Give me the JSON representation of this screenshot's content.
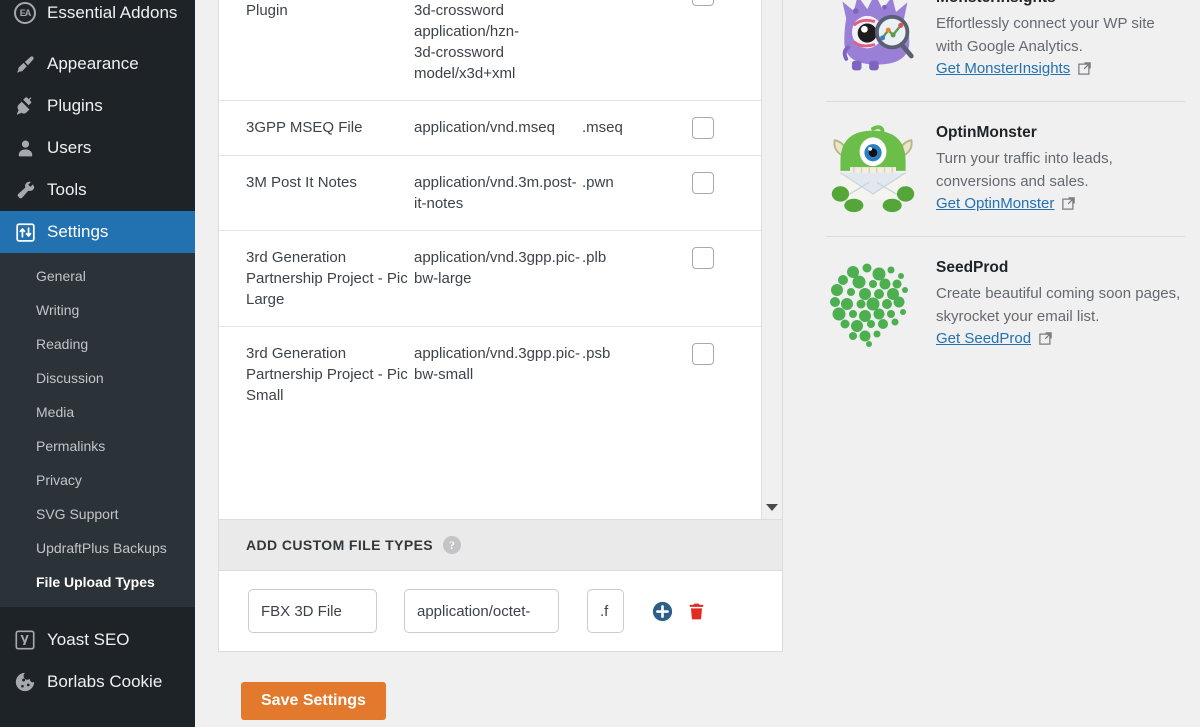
{
  "sidebar": {
    "top_items": [
      {
        "label": "Essential Addons",
        "icon": "essential-addons-icon"
      },
      {
        "label": "Appearance",
        "icon": "paintbrush-icon"
      },
      {
        "label": "Plugins",
        "icon": "plug-icon"
      },
      {
        "label": "Users",
        "icon": "user-icon"
      },
      {
        "label": "Tools",
        "icon": "wrench-icon"
      },
      {
        "label": "Settings",
        "icon": "sliders-icon",
        "current": true
      }
    ],
    "submenu": [
      {
        "label": "General"
      },
      {
        "label": "Writing"
      },
      {
        "label": "Reading"
      },
      {
        "label": "Discussion"
      },
      {
        "label": "Media"
      },
      {
        "label": "Permalinks"
      },
      {
        "label": "Privacy"
      },
      {
        "label": "SVG Support"
      },
      {
        "label": "UpdraftPlus Backups"
      },
      {
        "label": "File Upload Types",
        "current": true
      }
    ],
    "bottom_items": [
      {
        "label": "Yoast SEO",
        "icon": "yoast-icon"
      },
      {
        "label": "Borlabs Cookie",
        "icon": "borlabs-cookie-icon"
      }
    ],
    "accent_current": "#2271b1",
    "background": "#1d2327",
    "submenu_background": "#2c3338"
  },
  "file_types_table": {
    "rows": [
      {
        "description": "Plugin",
        "mime": "3d-crossword\napplication/hzn-\n3d-crossword\nmodel/x3d+xml",
        "extension": "",
        "checked": false,
        "clipped": true
      },
      {
        "description": "3GPP MSEQ File",
        "mime": "application/vnd.mseq",
        "extension": ".mseq",
        "checked": false
      },
      {
        "description": "3M Post It Notes",
        "mime": "application/vnd.3m.post-\nit-notes",
        "extension": ".pwn",
        "checked": false
      },
      {
        "description": "3rd Generation Partnership Project - Pic Large",
        "mime": "application/vnd.3gpp.pic-\nbw-large",
        "extension": ".plb",
        "checked": false
      },
      {
        "description": "3rd Generation Partnership Project - Pic Small",
        "mime": "application/vnd.3gpp.pic-\nbw-small",
        "extension": ".psb",
        "checked": false
      }
    ]
  },
  "add_custom_section": {
    "heading": "ADD CUSTOM FILE TYPES",
    "help_glyph": "?",
    "row": {
      "description_value": "FBX 3D File",
      "mime_value": "application/octet-",
      "extension_value": ".f",
      "add_icon": "add-circle-icon",
      "delete_icon": "trash-icon",
      "add_color": "#2c5f8a",
      "delete_color": "#e02b20"
    }
  },
  "actions": {
    "save_label": "Save Settings",
    "save_color": "#e2792d"
  },
  "promos": [
    {
      "name": "MonsterInsights",
      "description": "Effortlessly connect your WP site with Google Analytics.",
      "link_label": "Get MonsterInsights",
      "link_icon": "external-link-icon",
      "thumb": "monsterinsights-logo",
      "color": "#8c68cd"
    },
    {
      "name": "OptinMonster",
      "description": "Turn your traffic into leads, conversions and sales.",
      "link_label": "Get OptinMonster",
      "link_icon": "external-link-icon",
      "thumb": "optinmonster-logo",
      "color": "#6bbe4a"
    },
    {
      "name": "SeedProd",
      "description": "Create beautiful coming soon pages, skyrocket your email list.",
      "link_label": "Get SeedProd",
      "link_icon": "external-link-icon",
      "thumb": "seedprod-logo",
      "color": "#4caf50"
    }
  ]
}
